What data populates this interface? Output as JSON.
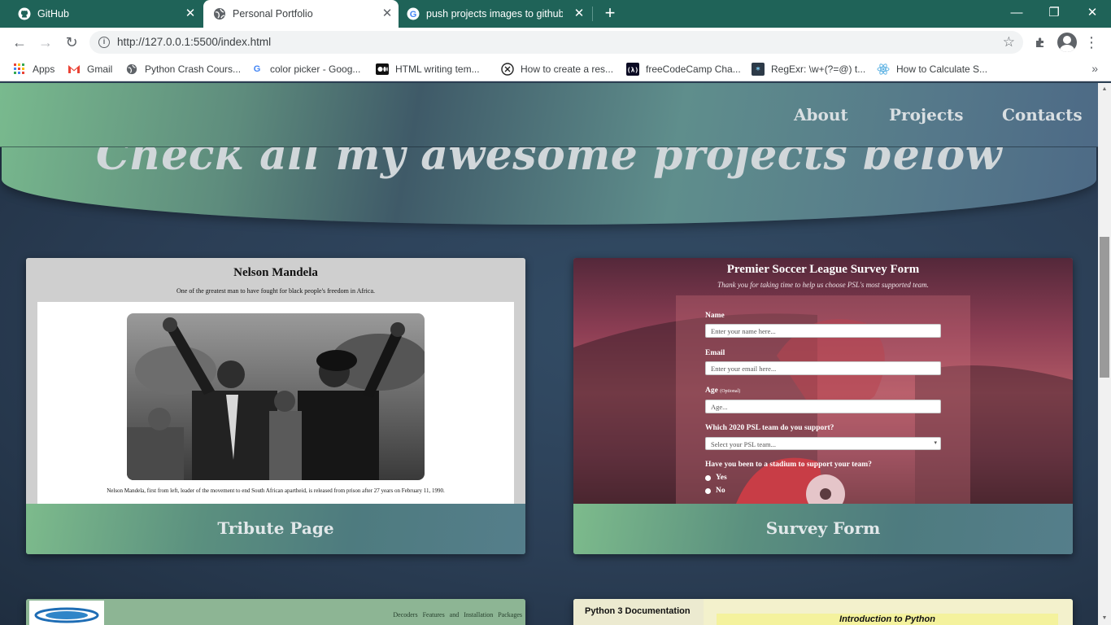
{
  "browser": {
    "tabs": [
      {
        "title": "GitHub",
        "icon": "github-icon"
      },
      {
        "title": "Personal Portfolio",
        "icon": "globe-icon"
      },
      {
        "title": "push projects images to github -",
        "icon": "google-icon"
      }
    ],
    "url": "http://127.0.0.1:5500/index.html",
    "bookmarks": [
      {
        "label": "Apps",
        "icon": "apps-grid-icon"
      },
      {
        "label": "Gmail",
        "icon": "gmail-icon"
      },
      {
        "label": "Python Crash Cours...",
        "icon": "globe-icon"
      },
      {
        "label": "color picker - Goog...",
        "icon": "google-icon"
      },
      {
        "label": "HTML  writing tem...",
        "icon": "medium-icon"
      },
      {
        "label": "How to create a res...",
        "icon": "circle-x-icon"
      },
      {
        "label": "freeCodeCamp Cha...",
        "icon": "freecodecamp-icon"
      },
      {
        "label": "RegExr: \\w+(?=@) t...",
        "icon": "regexr-icon"
      },
      {
        "label": "How to Calculate S...",
        "icon": "react-icon"
      }
    ],
    "colors": {
      "tabbar": "#1f6358",
      "accent": "#79ba8e"
    }
  },
  "page": {
    "nav": {
      "about": "About",
      "projects": "Projects",
      "contacts": "Contacts"
    },
    "hero_heading": "Check all my awesome projects below",
    "projects": [
      {
        "title": "Tribute Page",
        "preview": {
          "heading": "Nelson Mandela",
          "subheading": "One of the greatest man to have fought for black people's freedom in Africa.",
          "caption": "Nelson Mandela, first from left, leader of the movement to end South African apartheid, is released from prison after 27 years on February 11, 1990."
        }
      },
      {
        "title": "Survey Form",
        "preview": {
          "heading": "Premier Soccer League Survey Form",
          "subheading": "Thank you for taking time to help us choose PSL's most supported team.",
          "name_label": "Name",
          "name_placeholder": "Enter your name here...",
          "email_label": "Email",
          "email_placeholder": "Enter your email here...",
          "age_label": "Age",
          "age_hint": "(Optional)",
          "age_placeholder": "Age...",
          "team_label": "Which 2020 PSL team do you support?",
          "team_placeholder": "Select your PSL team...",
          "stadium_label": "Have you been to a stadium to support your team?",
          "yes": "Yes",
          "no": "No"
        }
      },
      {
        "preview": {
          "links": "Decoders  Features and Installation  Packages"
        }
      },
      {
        "preview": {
          "sidebar_title": "Python 3 Documentation",
          "main_title": "Introduction to Python"
        }
      }
    ]
  }
}
